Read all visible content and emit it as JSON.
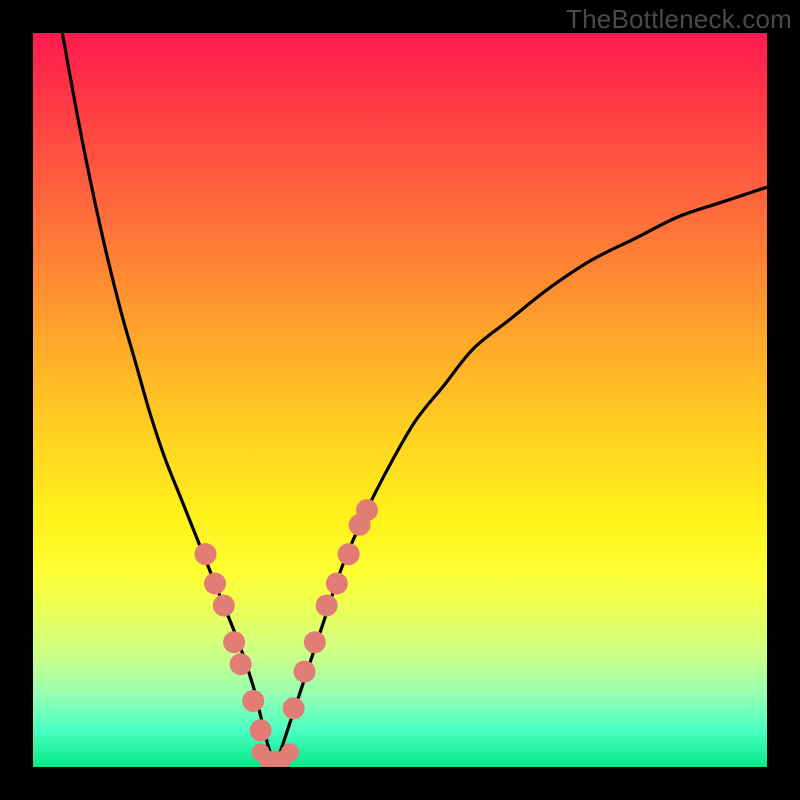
{
  "watermark": "TheBottleneck.com",
  "colors": {
    "background": "#000000",
    "curve": "#000000",
    "marker": "#e27d76",
    "watermark": "#4a4a4a"
  },
  "chart_data": {
    "type": "line",
    "title": "",
    "xlabel": "",
    "ylabel": "",
    "xlim": [
      0,
      100
    ],
    "ylim": [
      0,
      100
    ],
    "grid": false,
    "legend": false,
    "axes_visible": false,
    "series": [
      {
        "name": "left-curve",
        "x": [
          4,
          6,
          8,
          10,
          12,
          14,
          16,
          18,
          20,
          22,
          24,
          26,
          28,
          30,
          31,
          32,
          33
        ],
        "y": [
          100,
          89,
          79,
          70,
          62,
          55,
          48,
          42,
          37,
          32,
          27,
          22,
          17,
          11,
          7,
          3,
          0
        ]
      },
      {
        "name": "right-curve",
        "x": [
          33,
          34,
          36,
          38,
          40,
          42,
          45,
          48,
          52,
          56,
          60,
          65,
          70,
          76,
          82,
          88,
          94,
          100
        ],
        "y": [
          0,
          3,
          9,
          15,
          21,
          27,
          34,
          40,
          47,
          52,
          57,
          61,
          65,
          69,
          72,
          75,
          77,
          79
        ]
      },
      {
        "name": "markers-left",
        "x": [
          23.5,
          24.8,
          26.0,
          27.4,
          28.3,
          30.0,
          31.0
        ],
        "y": [
          29,
          25,
          22,
          17,
          14,
          9,
          5
        ]
      },
      {
        "name": "markers-right",
        "x": [
          35.5,
          37.0,
          38.4,
          40.0,
          41.4,
          43.0,
          44.5,
          45.5
        ],
        "y": [
          8,
          13,
          17,
          22,
          25,
          29,
          33,
          35
        ]
      },
      {
        "name": "floor",
        "x": [
          31,
          32,
          33,
          34,
          35
        ],
        "y": [
          2,
          1,
          1,
          1,
          2
        ]
      }
    ],
    "background_gradient_stops": [
      {
        "pos": 0,
        "color": "#ff1a4f"
      },
      {
        "pos": 24,
        "color": "#ff6a3b"
      },
      {
        "pos": 52,
        "color": "#ffc922"
      },
      {
        "pos": 74,
        "color": "#fdff35"
      },
      {
        "pos": 90,
        "color": "#96ffb0"
      },
      {
        "pos": 100,
        "color": "#06e787"
      }
    ]
  }
}
